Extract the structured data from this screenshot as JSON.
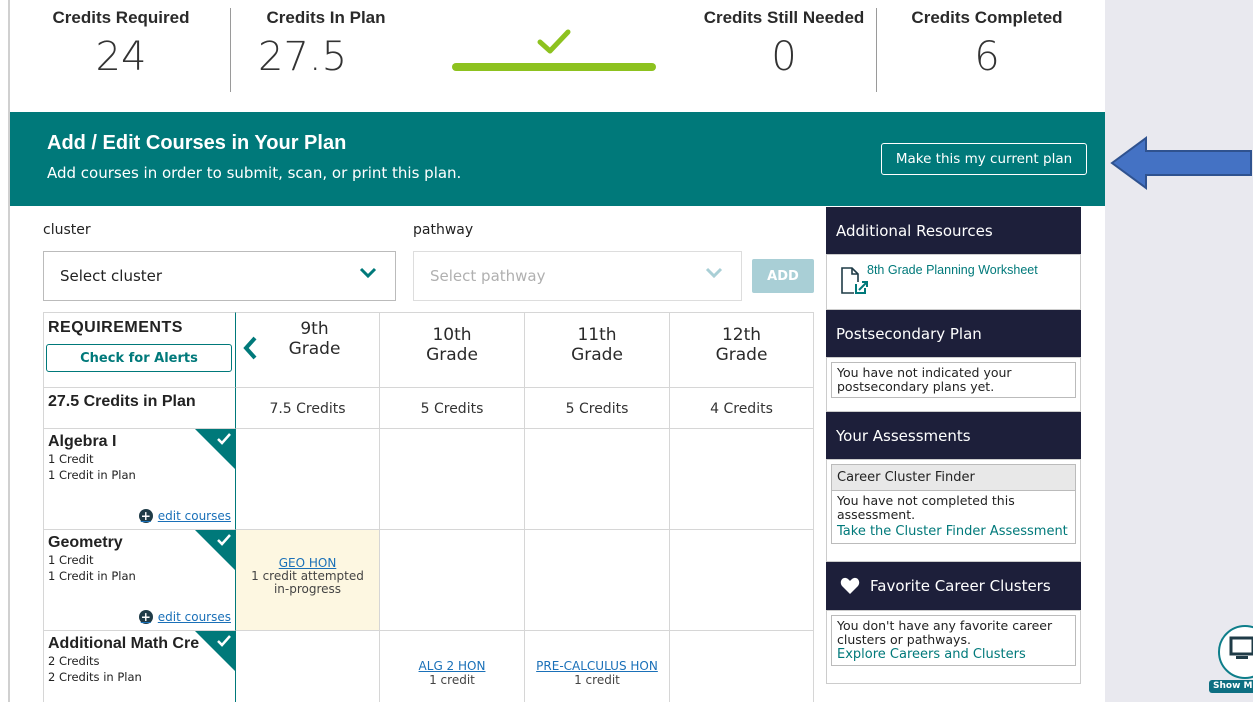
{
  "summary": {
    "credits_required": {
      "label": "Credits Required",
      "value": "24"
    },
    "credits_in_plan": {
      "label": "Credits In Plan",
      "value": "27.5"
    },
    "credits_still_needed": {
      "label": "Credits Still Needed",
      "value": "0"
    },
    "credits_completed": {
      "label": "Credits Completed",
      "value": "6"
    },
    "progress_fraction": 1.0,
    "accent_color": "#8dc21f"
  },
  "banner": {
    "title": "Add / Edit Courses in Your Plan",
    "subtitle": "Add courses in order to submit, scan, or print this plan.",
    "button_label": "Make this my current plan",
    "color": "#00797a"
  },
  "filters": {
    "cluster_label": "cluster",
    "cluster_value": "Select cluster",
    "pathway_label": "pathway",
    "pathway_placeholder": "Select pathway",
    "add_label": "ADD"
  },
  "grid": {
    "requirements_header": "REQUIREMENTS",
    "check_alerts": "Check for Alerts",
    "total_credits": "27.5 Credits in Plan",
    "grades": [
      {
        "line1": "9th",
        "line2": "Grade",
        "credits": "7.5 Credits"
      },
      {
        "line1": "10th",
        "line2": "Grade",
        "credits": "5 Credits"
      },
      {
        "line1": "11th",
        "line2": "Grade",
        "credits": "5 Credits"
      },
      {
        "line1": "12th",
        "line2": "Grade",
        "credits": "4 Credits"
      }
    ],
    "requirements": [
      {
        "title": "Algebra I",
        "credits": "1 Credit",
        "in_plan": "1 Credit in Plan",
        "edit": "edit courses"
      },
      {
        "title": "Geometry",
        "credits": "1 Credit",
        "in_plan": "1 Credit in Plan",
        "edit": "edit courses",
        "course": {
          "name": "GEO HON",
          "line1": "1 credit attempted",
          "line2": "in-progress"
        }
      },
      {
        "title": "Additional Math Cre",
        "credits": "2 Credits",
        "in_plan": "2 Credits in Plan",
        "courses": [
          {
            "name": "ALG 2 HON",
            "sub": "1 credit"
          },
          {
            "name": "PRE-CALCULUS HON",
            "sub": "1 credit"
          }
        ]
      }
    ]
  },
  "sidebar": {
    "additional_resources": {
      "title": "Additional Resources",
      "link": "8th Grade Planning Worksheet"
    },
    "postsecondary": {
      "title": "Postsecondary Plan",
      "text": "You have not indicated your postsecondary plans yet."
    },
    "assessments": {
      "title": "Your Assessments",
      "box_title": "Career Cluster Finder",
      "text": "You have not completed this assessment.",
      "link": "Take the Cluster Finder Assessment"
    },
    "favorites": {
      "title": "Favorite Career Clusters",
      "text": "You don't have any favorite career clusters or pathways.",
      "link": "Explore Careers and Clusters"
    }
  },
  "show_me": {
    "label": "Show M"
  }
}
